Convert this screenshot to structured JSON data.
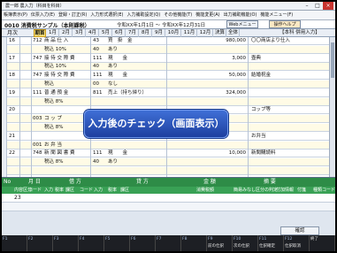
{
  "window": {
    "title": "農一郎 農入力（科目を科目）",
    "buttons": [
      "–",
      "□",
      "×"
    ]
  },
  "menu": [
    "帳簿表示(P)",
    "伝票入力(E)",
    "登録・訂正(R)",
    "入力形式選択(E)",
    "入力補助設定(Q)",
    "その他機能(T)",
    "機能変更(A)",
    "出力補助機能(O)",
    "機能メニュー(F)"
  ],
  "doc": {
    "title": "0010 消費税サンプル（本則課税）",
    "period": "令和XX年1月1日 ～ 令和XX年12月31日",
    "web_button": "Webメニュー",
    "help_button": "操作ヘルプ"
  },
  "months": {
    "label": "月次",
    "active": "期首",
    "items": [
      "期首",
      "1月",
      "2月",
      "3月",
      "4月",
      "5月",
      "6月",
      "7月",
      "8月",
      "9月",
      "10月",
      "11月",
      "12月",
      "決算",
      "全体"
    ],
    "right": "【本科 併用入力】"
  },
  "ledger_rows": [
    {
      "no": "16",
      "code": "712",
      "text": "商 品 仕 入",
      "sub": "43",
      "name": "買　掛　金",
      "amount": "980,000",
      "memo": "〇〇商店より仕入"
    },
    {
      "no": "",
      "code": "",
      "text": "税込 10%",
      "sub": "40",
      "name": "あり",
      "amount": "",
      "memo": ""
    },
    {
      "no": "17",
      "code": "747",
      "text": "接 待 交 際 費",
      "sub": "111",
      "name": "現　　金",
      "amount": "3,000",
      "memo": "壺典"
    },
    {
      "no": "",
      "code": "",
      "text": "税込 10%",
      "sub": "40",
      "name": "あり",
      "amount": "",
      "memo": ""
    },
    {
      "no": "18",
      "code": "747",
      "text": "接 待 交 際 費",
      "sub": "111",
      "name": "現　　金",
      "amount": "50,000",
      "memo": "結婚祝金"
    },
    {
      "no": "",
      "code": "",
      "text": "税込",
      "sub": "00",
      "name": "なし",
      "amount": "",
      "memo": ""
    },
    {
      "no": "19",
      "code": "111",
      "text": "普 通 預 金",
      "sub": "811",
      "name": "売上（持ち帰り）",
      "amount": "324,000",
      "memo": ""
    },
    {
      "no": "",
      "code": "",
      "text": "税込 8%",
      "sub": "",
      "name": "",
      "amount": "",
      "memo": ""
    },
    {
      "no": "20",
      "code": "",
      "text": "",
      "sub": "",
      "name": "",
      "amount": "",
      "memo": "コップ等"
    },
    {
      "no": "",
      "code": "003",
      "text": "コ ッ プ",
      "sub": "",
      "name": "",
      "amount": "",
      "memo": ""
    },
    {
      "no": "",
      "code": "",
      "text": "税込 8%",
      "sub": "",
      "name": "",
      "amount": "",
      "memo": ""
    },
    {
      "no": "21",
      "code": "",
      "text": "",
      "sub": "",
      "name": "",
      "amount": "",
      "memo": "お弁当"
    },
    {
      "no": "",
      "code": "001",
      "text": "お 弁 当",
      "sub": "",
      "name": "",
      "amount": "",
      "memo": ""
    },
    {
      "no": "22",
      "code": "748",
      "text": "新 聞 図 書 費",
      "sub": "111",
      "name": "現　　金",
      "amount": "10,000",
      "memo": "新聞購読料"
    },
    {
      "no": "",
      "code": "",
      "text": "税込 8%",
      "sub": "40",
      "name": "あり",
      "amount": "",
      "memo": ""
    },
    {
      "no": "",
      "code": "",
      "text": "",
      "sub": "",
      "name": "",
      "amount": "",
      "memo": ""
    }
  ],
  "callout": "入力後のチェック（画面表示）",
  "entry": {
    "head1": {
      "no": "No",
      "month": "月 日",
      "debit": "借 方",
      "credit": "貸 方",
      "amount": "金 額",
      "memo": "摘 要"
    },
    "head2": [
      "内容区分",
      "コード",
      "入力",
      "税率",
      "課区",
      "コード",
      "入力",
      "税率",
      "課区",
      "消費税額",
      "簡易みなし区分の判定",
      "付加情報",
      "付箋",
      "種類コード"
    ],
    "row_no": "23",
    "confirm": "確認"
  },
  "fkeys": [
    {
      "key": "F1",
      "label": ""
    },
    {
      "key": "F2",
      "label": ""
    },
    {
      "key": "F3",
      "label": ""
    },
    {
      "key": "F4",
      "label": ""
    },
    {
      "key": "F5",
      "label": ""
    },
    {
      "key": "F6",
      "label": ""
    },
    {
      "key": "F7",
      "label": ""
    },
    {
      "key": "F8",
      "label": ""
    },
    {
      "key": "F9",
      "label": "前の仕訳"
    },
    {
      "key": "F10",
      "label": "次の仕訳"
    },
    {
      "key": "F11",
      "label": "仕訳確定"
    },
    {
      "key": "F12",
      "label": "仕訳取消"
    },
    {
      "key": "",
      "label": "終了"
    }
  ]
}
